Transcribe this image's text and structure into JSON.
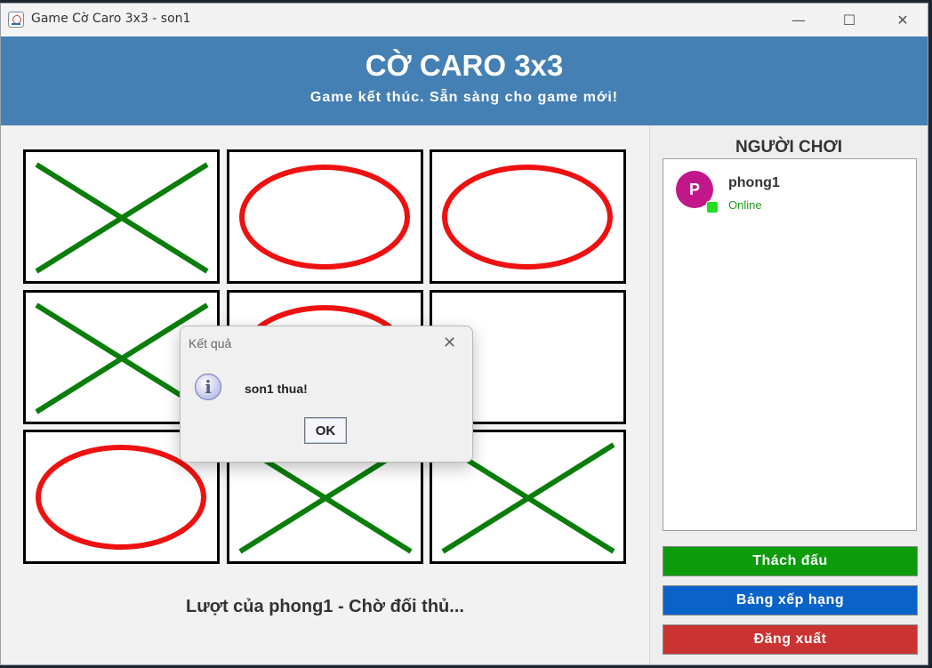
{
  "window": {
    "title": "Game Cờ Caro 3x3 - son1",
    "controls": {
      "minimize": "—",
      "maximize": "☐",
      "close": "✕"
    }
  },
  "header": {
    "title": "CỜ CARO 3x3",
    "status": "Game kết thúc. Sẵn sàng cho game mới!"
  },
  "board": {
    "cells": [
      "X",
      "O",
      "O",
      "X",
      "O",
      "",
      "O",
      "X",
      "X"
    ],
    "x_color": "#0a7d0a",
    "o_color": "#ee1111",
    "turn_text": "Lượt của phong1 - Chờ đối thủ..."
  },
  "sidebar": {
    "title": "NGƯỜI CHƠI",
    "players": [
      {
        "initial": "P",
        "name": "phong1",
        "status": "Online"
      }
    ],
    "buttons": {
      "challenge": "Thách đấu",
      "ranking": "Bảng xếp hạng",
      "logout": "Đăng xuất"
    }
  },
  "dialog": {
    "title": "Kết quả",
    "icon": "info-icon",
    "message": "son1 thua!",
    "ok_label": "OK",
    "close_glyph": "✕"
  }
}
